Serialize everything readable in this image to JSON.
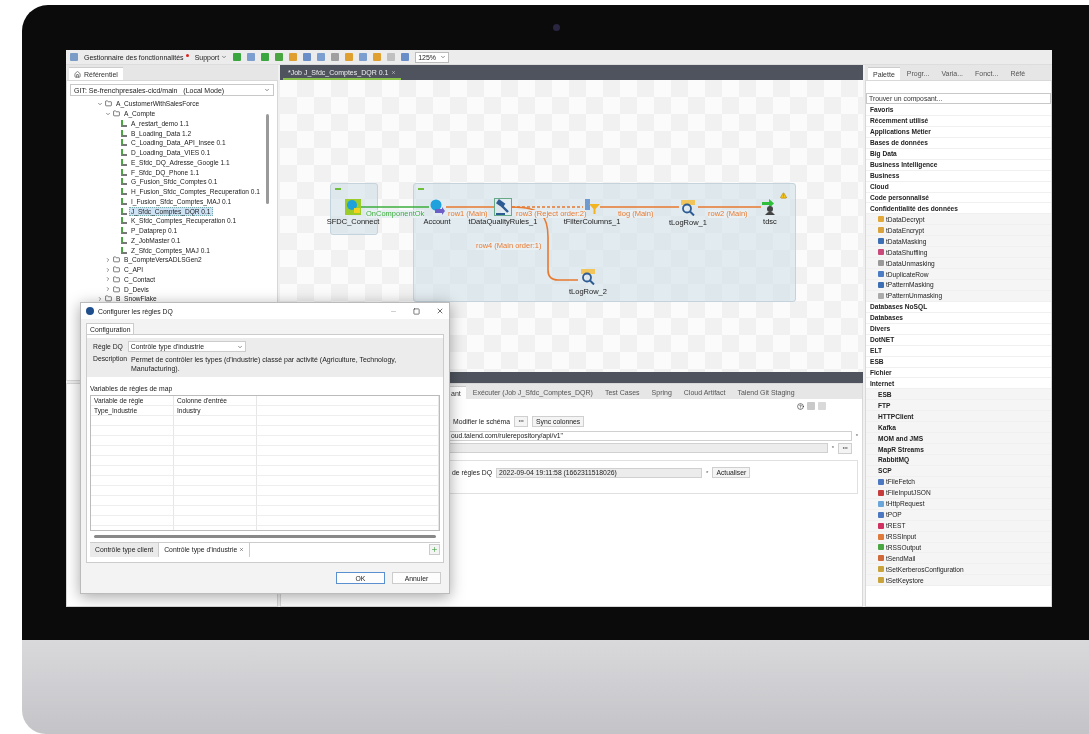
{
  "menu_bar": {
    "feature_manager": "Gestionnaire des fonctionnalités",
    "feature_manager_notification": true,
    "support": "Support",
    "zoom": "125%"
  },
  "repository": {
    "tab": "Référentiel",
    "branch": "GIT: Se-frenchpresales-cicd/main   (Local Mode)",
    "tree": [
      {
        "label": "A_CustomerWithSalesForce",
        "kind": "folder",
        "expanded": true,
        "selected": false,
        "children": [
          {
            "label": "A_Compte",
            "kind": "folder",
            "expanded": true,
            "selected": false,
            "children": [
              {
                "label": "A_restart_demo 1.1",
                "kind": "job",
                "selected": false
              },
              {
                "label": "B_Loading_Data 1.2",
                "kind": "job",
                "selected": false
              },
              {
                "label": "C_Loading_Data_API_Insee 0.1",
                "kind": "job",
                "selected": false
              },
              {
                "label": "D_Loading_Data_VIES 0.1",
                "kind": "job",
                "selected": false
              },
              {
                "label": "E_Sfdc_DQ_Adresse_Google 1.1",
                "kind": "job",
                "selected": false
              },
              {
                "label": "F_Sfdc_DQ_Phone 1.1",
                "kind": "job",
                "selected": false
              },
              {
                "label": "G_Fusion_Sfdc_Comptes 0.1",
                "kind": "job",
                "selected": false
              },
              {
                "label": "H_Fusion_Sfdc_Comptes_Recuperation 0.1",
                "kind": "job",
                "selected": false
              },
              {
                "label": "I_Fusion_Sfdc_Comptes_MAJ 0.1",
                "kind": "job",
                "selected": false
              },
              {
                "label": "J_Sfdc_Comptes_DQR 0.1",
                "kind": "job",
                "selected": true
              },
              {
                "label": "K_Sfdc_Comptes_Recuperation 0.1",
                "kind": "job",
                "selected": false
              },
              {
                "label": "P_Dataprep 0.1",
                "kind": "job",
                "selected": false
              },
              {
                "label": "Z_JobMaster 0.1",
                "kind": "job",
                "selected": false
              },
              {
                "label": "Z_Sfdc_Comptes_MAJ 0.1",
                "kind": "job",
                "selected": false
              }
            ]
          },
          {
            "label": "B_CompteVersADLSGen2",
            "kind": "folder",
            "expanded": false,
            "selected": false
          },
          {
            "label": "C_API",
            "kind": "folder",
            "expanded": false,
            "selected": false
          },
          {
            "label": "C_Contact",
            "kind": "folder",
            "expanded": false,
            "selected": false
          },
          {
            "label": "D_Devis",
            "kind": "folder",
            "expanded": false,
            "selected": false
          }
        ]
      },
      {
        "label": "B_SnowFlake",
        "kind": "folder",
        "expanded": false,
        "selected": false
      }
    ]
  },
  "editor": {
    "tab": "*Job J_Sfdc_Comptes_DQR 0.1",
    "nodes": [
      {
        "label": "SFDC_Connect",
        "kind": "salesforce-connect",
        "selected": false,
        "warning": false
      },
      {
        "label": "Account",
        "kind": "salesforce-input",
        "selected": false,
        "warning": false
      },
      {
        "label": "tDataQualityRules_1",
        "kind": "rules",
        "selected": true,
        "warning": false
      },
      {
        "label": "tFilterColumns_1",
        "kind": "filter",
        "selected": false,
        "warning": false
      },
      {
        "label": "tLogRow_1",
        "kind": "log",
        "selected": false,
        "warning": false
      },
      {
        "label": "tdsc",
        "kind": "output",
        "selected": false,
        "warning": true
      },
      {
        "label": "tLogRow_2",
        "kind": "log",
        "selected": false,
        "warning": false
      }
    ],
    "links": [
      {
        "label": "OnComponentOk",
        "kind": "trigger"
      },
      {
        "label": "row1 (Main)",
        "kind": "main"
      },
      {
        "label": "row3 (Reject order:2)",
        "kind": "reject"
      },
      {
        "label": "tlog (Main)",
        "kind": "main"
      },
      {
        "label": "row2 (Main)",
        "kind": "main"
      },
      {
        "label": "row4 (Main order:1)",
        "kind": "main"
      }
    ]
  },
  "component_panel": {
    "tabs": [
      {
        "label": "ant",
        "selected": true
      },
      {
        "label": "Exécuter (Job J_Sfdc_Comptes_DQR)",
        "selected": false
      },
      {
        "label": "Test Cases",
        "selected": false
      },
      {
        "label": "Spring",
        "selected": false
      },
      {
        "label": "Cloud Artifact",
        "selected": false
      },
      {
        "label": "Talend Git Staging",
        "selected": false
      }
    ],
    "schema_label": "Modifier le schéma",
    "sync_button": "Sync colonnes",
    "url": "oud.talend.com/rulerepository/api/v1\"",
    "url_mark": "*",
    "credential_mark": "*",
    "rules_label": "de règles DQ",
    "rules_version": "2022-09-04 19:11:58 (1662311518026)",
    "rules_version_mark": "*",
    "refresh_button": "Actualiser"
  },
  "palette": {
    "tabs": [
      {
        "label": "Palette",
        "selected": true
      },
      {
        "label": "Progr...",
        "selected": false
      },
      {
        "label": "Varia...",
        "selected": false
      },
      {
        "label": "Fonct...",
        "selected": false
      },
      {
        "label": "Réfé",
        "selected": false
      }
    ],
    "search": {
      "placeholder": "Trouver un composant..."
    },
    "items": [
      {
        "label": "Favoris",
        "kind": "category"
      },
      {
        "label": "Récemment utilisé",
        "kind": "category"
      },
      {
        "label": "Applications Métier",
        "kind": "category"
      },
      {
        "label": "Bases de données",
        "kind": "category"
      },
      {
        "label": "Big Data",
        "kind": "category"
      },
      {
        "label": "Business Intelligence",
        "kind": "category"
      },
      {
        "label": "Business",
        "kind": "category"
      },
      {
        "label": "Cloud",
        "kind": "category"
      },
      {
        "label": "Code personnalisé",
        "kind": "category"
      },
      {
        "label": "Confidentialité des données",
        "kind": "category"
      },
      {
        "label": "tDataDecrypt",
        "kind": "component"
      },
      {
        "label": "tDataEncrypt",
        "kind": "component"
      },
      {
        "label": "tDataMasking",
        "kind": "component"
      },
      {
        "label": "tDataShuffling",
        "kind": "component"
      },
      {
        "label": "tDataUnmasking",
        "kind": "component"
      },
      {
        "label": "tDuplicateRow",
        "kind": "component"
      },
      {
        "label": "tPatternMasking",
        "kind": "component"
      },
      {
        "label": "tPatternUnmasking",
        "kind": "component"
      },
      {
        "label": "Databases NoSQL",
        "kind": "category"
      },
      {
        "label": "Databases",
        "kind": "category"
      },
      {
        "label": "Divers",
        "kind": "category"
      },
      {
        "label": "DotNET",
        "kind": "category"
      },
      {
        "label": "ELT",
        "kind": "category"
      },
      {
        "label": "ESB",
        "kind": "category"
      },
      {
        "label": "Fichier",
        "kind": "category"
      },
      {
        "label": "Internet",
        "kind": "category"
      },
      {
        "label": "ESB",
        "kind": "subcategory"
      },
      {
        "label": "FTP",
        "kind": "subcategory"
      },
      {
        "label": "HTTPClient",
        "kind": "subcategory"
      },
      {
        "label": "Kafka",
        "kind": "subcategory"
      },
      {
        "label": "MOM and JMS",
        "kind": "subcategory"
      },
      {
        "label": "MapR Streams",
        "kind": "subcategory"
      },
      {
        "label": "RabbitMQ",
        "kind": "subcategory"
      },
      {
        "label": "SCP",
        "kind": "subcategory"
      },
      {
        "label": "tFileFetch",
        "kind": "component"
      },
      {
        "label": "tFileInputJSON",
        "kind": "component"
      },
      {
        "label": "tHttpRequest",
        "kind": "component"
      },
      {
        "label": "tPOP",
        "kind": "component"
      },
      {
        "label": "tREST",
        "kind": "component"
      },
      {
        "label": "tRSSInput",
        "kind": "component"
      },
      {
        "label": "tRSSOutput",
        "kind": "component"
      },
      {
        "label": "tSendMail",
        "kind": "component"
      },
      {
        "label": "tSetKerberosConfiguration",
        "kind": "component"
      },
      {
        "label": "tSetKeystore",
        "kind": "component"
      }
    ]
  },
  "dialog": {
    "title": "Configurer les règles DQ",
    "tab": "Configuration",
    "rule_label": "Règle DQ",
    "rule_value": "Contrôle type d'industrie",
    "description_label": "Description",
    "description": "Permet de contrôler les types (d'industrie) classé par activité (Agriculture, Technology, Manufacturing).",
    "variables_title": "Variables de règles de map",
    "columns": [
      "Variable de règle",
      "Colonne d'entrée"
    ],
    "rows": [
      [
        "Type_Industrie",
        "Industry"
      ]
    ],
    "rule_tabs": [
      {
        "label": "Contrôle type client",
        "selected": false
      },
      {
        "label": "Contrôle type d'industrie",
        "selected": true
      }
    ],
    "buttons": [
      "OK",
      "Annuler"
    ]
  }
}
